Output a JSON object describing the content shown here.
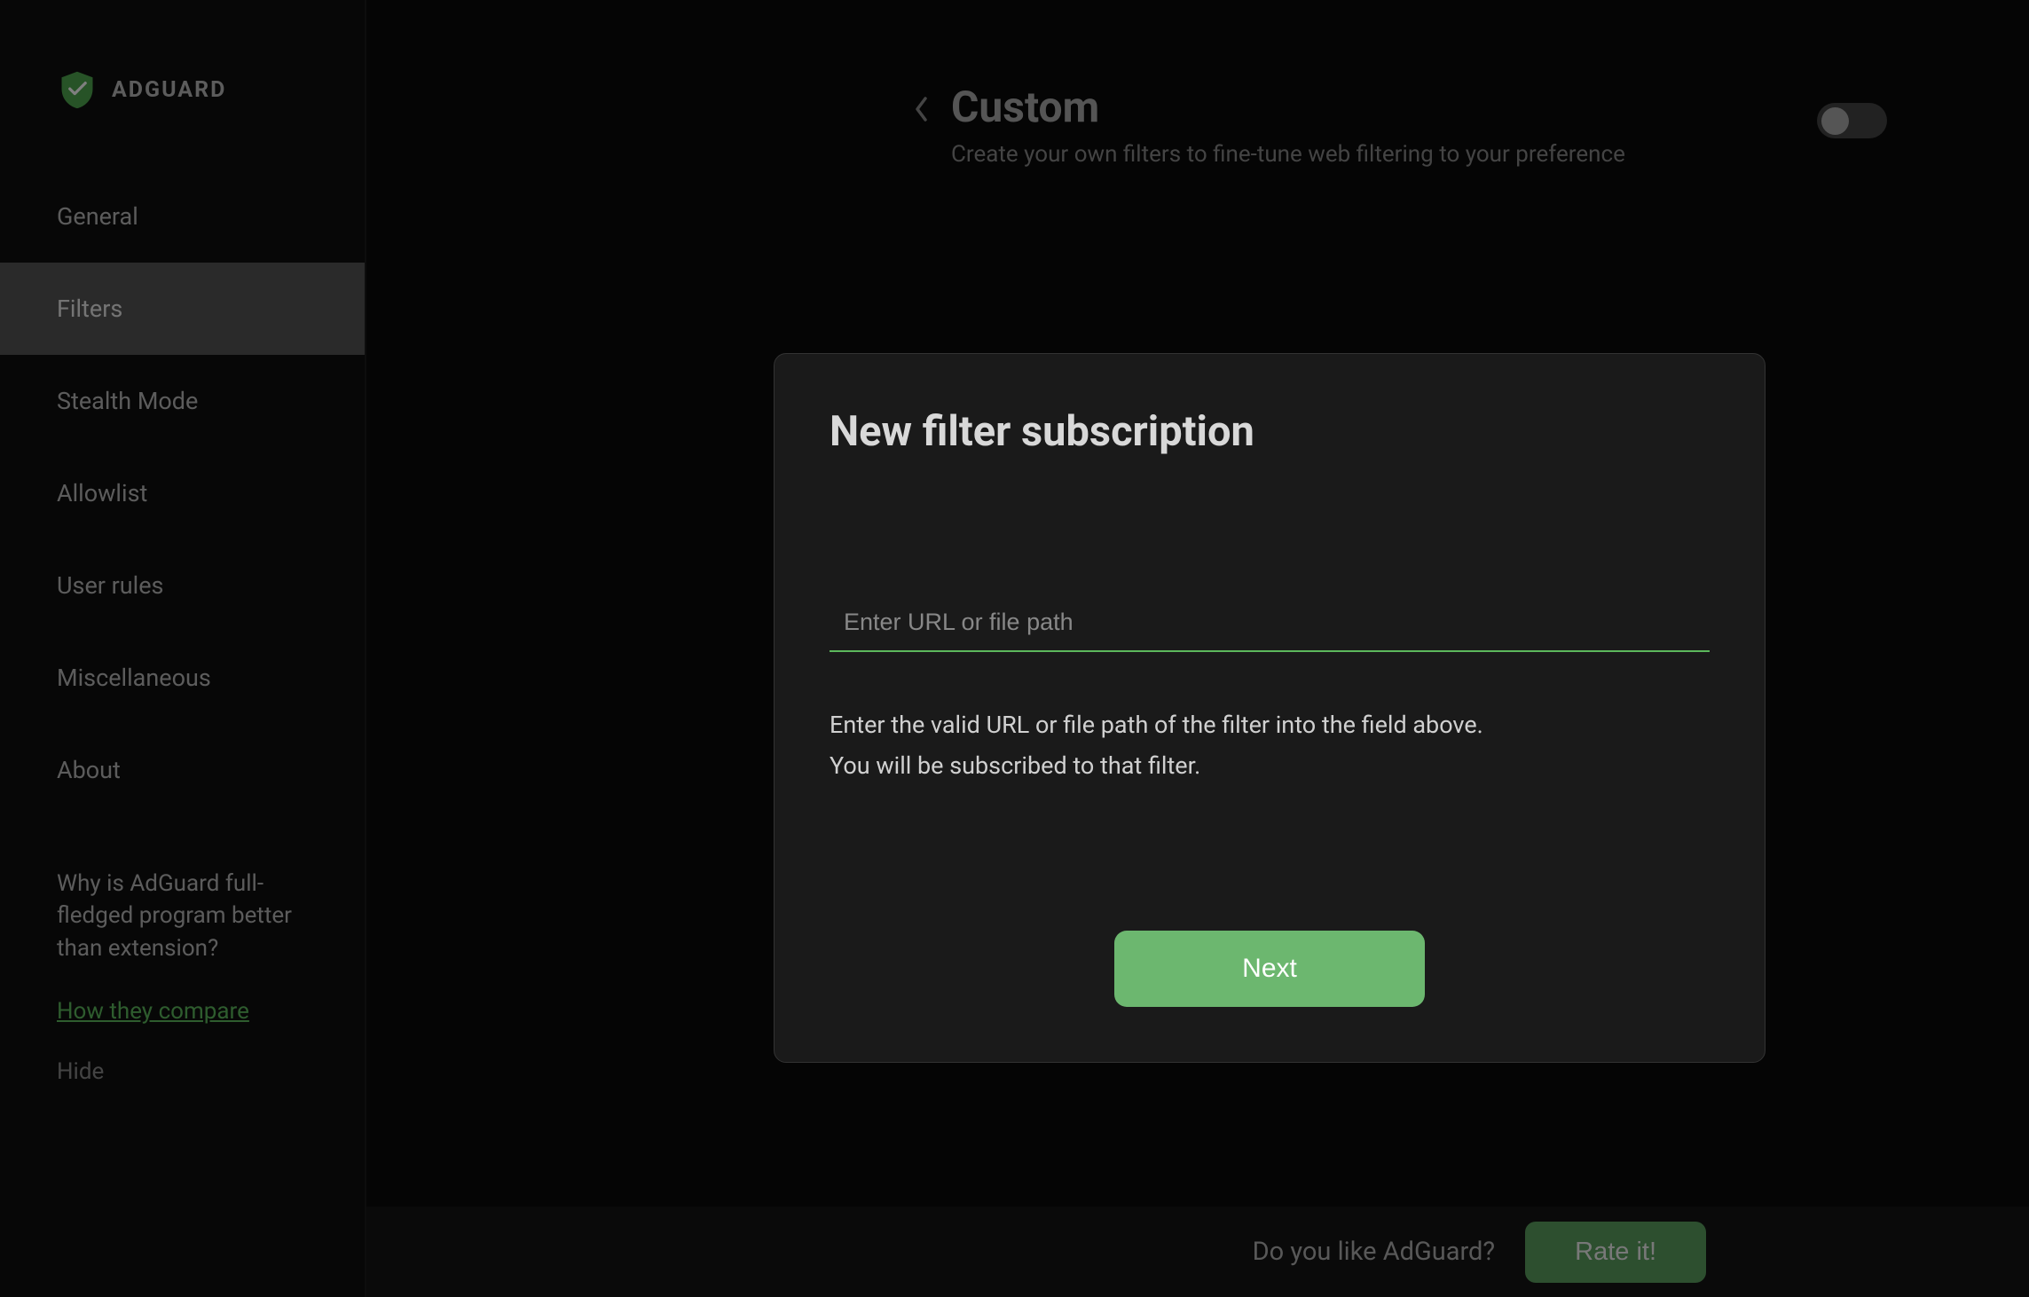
{
  "brand": {
    "name": "ADGUARD"
  },
  "sidebar": {
    "items": [
      {
        "label": "General"
      },
      {
        "label": "Filters"
      },
      {
        "label": "Stealth Mode"
      },
      {
        "label": "Allowlist"
      },
      {
        "label": "User rules"
      },
      {
        "label": "Miscellaneous"
      },
      {
        "label": "About"
      }
    ],
    "promo": {
      "text": "Why is AdGuard full-fledged program better than extension?",
      "link_label": "How they compare",
      "hide_label": "Hide"
    }
  },
  "header": {
    "title": "Custom",
    "subtitle": "Create your own filters to fine-tune web filtering to your preference",
    "toggle_on": false
  },
  "footer": {
    "prompt": "Do you like AdGuard?",
    "button_label": "Rate it!"
  },
  "modal": {
    "title": "New filter subscription",
    "input_placeholder": "Enter URL or file path",
    "input_value": "",
    "help_line_1": "Enter the valid URL or file path of the filter into the field above.",
    "help_line_2": "You will be subscribed to that filter.",
    "next_label": "Next"
  }
}
